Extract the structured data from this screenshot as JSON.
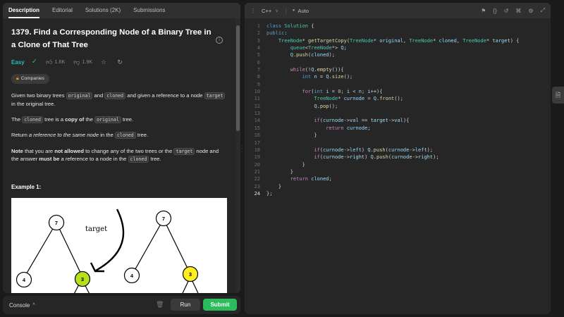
{
  "tabs": [
    {
      "label": "Description"
    },
    {
      "label": "Editorial"
    },
    {
      "label": "Solutions (2K)"
    },
    {
      "label": "Submissions"
    }
  ],
  "problem": {
    "title": "1379. Find a Corresponding Node of a Binary Tree in a Clone of That Tree",
    "difficulty": "Easy",
    "likes": "1.6K",
    "dislikes": "1.9K",
    "companies_label": "Companies",
    "p1": [
      "Given two binary trees ",
      "original",
      " and ",
      "cloned",
      " and given a reference to a node ",
      "target",
      " in the original tree."
    ],
    "p2": [
      "The ",
      "cloned",
      " tree is a ",
      "copy of",
      " the ",
      "original",
      " tree."
    ],
    "p3": [
      "Return ",
      "a reference to the same node",
      " in the ",
      "cloned",
      " tree."
    ],
    "p4": [
      "Note",
      " that you are ",
      "not allowed",
      " to change any of the two trees or the ",
      "target",
      " node and the answer ",
      "must be",
      " a reference to a node in the ",
      "cloned",
      " tree."
    ],
    "example_heading": "Example 1:",
    "figure": {
      "label": "target",
      "nodes": [
        "7",
        "4",
        "3",
        "7",
        "4",
        "3"
      ]
    }
  },
  "console": {
    "label": "Console",
    "run": "Run",
    "submit": "Submit"
  },
  "editor": {
    "language": "C++",
    "mode": "Auto",
    "line_numbers": [
      "1",
      "2",
      "3",
      "4",
      "5",
      "6",
      "7",
      "8",
      "9",
      "10",
      "11",
      "12",
      "13",
      "14",
      "15",
      "16",
      "17",
      "18",
      "19",
      "20",
      "21",
      "22",
      "23",
      "24"
    ]
  },
  "colors": {
    "accent_green": "#2cbb5d",
    "easy": "#2cbbbb",
    "target_node": "#b6e01b",
    "clone_node": "#ffee22"
  }
}
